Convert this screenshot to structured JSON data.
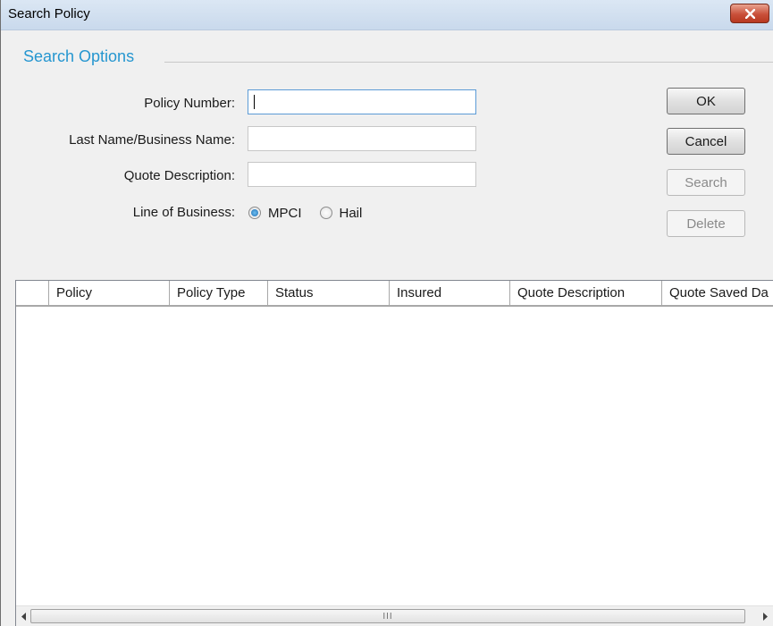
{
  "window": {
    "title": "Search Policy"
  },
  "search_options": {
    "group_label": "Search Options",
    "policy_number": {
      "label": "Policy Number:",
      "value": ""
    },
    "last_name": {
      "label": "Last Name/Business Name:",
      "value": ""
    },
    "quote_description": {
      "label": "Quote Description:",
      "value": ""
    },
    "line_of_business": {
      "label": "Line of Business:",
      "options": [
        "MPCI",
        "Hail"
      ],
      "selected": "MPCI"
    }
  },
  "buttons": {
    "ok": "OK",
    "cancel": "Cancel",
    "search": "Search",
    "delete": "Delete"
  },
  "grid": {
    "columns": [
      "",
      "Policy",
      "Policy Type",
      "Status",
      "Insured",
      "Quote Description",
      "Quote Saved Da"
    ],
    "rows": [],
    "scrollbar_grip": "III"
  },
  "icons": {
    "close": "close-x-icon",
    "scroll_left": "arrow-left-icon",
    "scroll_right": "arrow-right-icon"
  }
}
